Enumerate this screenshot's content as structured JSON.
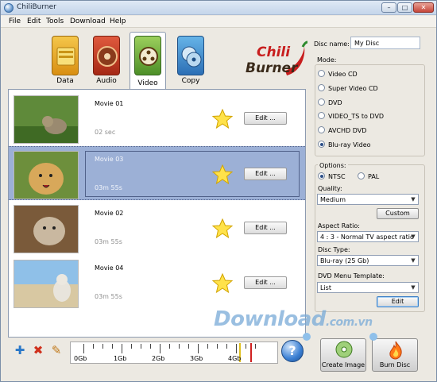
{
  "window": {
    "title": "ChiliBurner"
  },
  "menu": [
    "File",
    "Edit",
    "Tools",
    "Download",
    "Help"
  ],
  "tabs": [
    {
      "label": "Data",
      "icon": "folder-icon",
      "active": false
    },
    {
      "label": "Audio",
      "icon": "cd-audio-icon",
      "active": false
    },
    {
      "label": "Video",
      "icon": "film-reel-icon",
      "active": true
    },
    {
      "label": "Copy",
      "icon": "disc-copy-icon",
      "active": false
    }
  ],
  "logo": {
    "line1": "Chili",
    "line2": "Burner"
  },
  "movies": [
    {
      "title": "Movie 01",
      "duration": "02 sec",
      "edit_label": "Edit ...",
      "selected": false
    },
    {
      "title": "Movie 03",
      "duration": "03m 55s",
      "edit_label": "Edit ...",
      "selected": true
    },
    {
      "title": "Movie 02",
      "duration": "03m 55s",
      "edit_label": "Edit ...",
      "selected": false
    },
    {
      "title": "Movie 04",
      "duration": "03m 55s",
      "edit_label": "Edit ...",
      "selected": false
    }
  ],
  "settings": {
    "disc_name_label": "Disc name:",
    "disc_name_value": "My Disc",
    "mode_label": "Mode:",
    "modes": [
      "Video CD",
      "Super Video CD",
      "DVD",
      "VIDEO_TS to DVD",
      "AVCHD DVD",
      "Blu-ray Video"
    ],
    "mode_selected": "Blu-ray Video",
    "options_label": "Options:",
    "ntsc_label": "NTSC",
    "pal_label": "PAL",
    "standard_selected": "NTSC",
    "quality_label": "Quality:",
    "quality_value": "Medium",
    "custom_button": "Custom",
    "aspect_label": "Aspect Ratio:",
    "aspect_value": "4 : 3 - Normal TV aspect ratio",
    "disc_type_label": "Disc Type:",
    "disc_type_value": "Blu-ray (25 Gb)",
    "menu_template_label": "DVD Menu Template:",
    "menu_template_value": "List",
    "edit_button": "Edit"
  },
  "toolbar": {
    "add_icon": "plus-icon",
    "remove_icon": "x-icon",
    "clear_icon": "pencil-icon"
  },
  "capacity": {
    "labels": [
      "0Gb",
      "1Gb",
      "2Gb",
      "3Gb",
      "4Gb"
    ],
    "marker_color_used": "#e0c020",
    "marker_color_limit": "#d02020"
  },
  "actions": {
    "help_label": "?",
    "create_image_label": "Create Image",
    "burn_disc_label": "Burn Disc"
  },
  "watermark": {
    "text": "Download",
    "domain": ".com.vn"
  }
}
